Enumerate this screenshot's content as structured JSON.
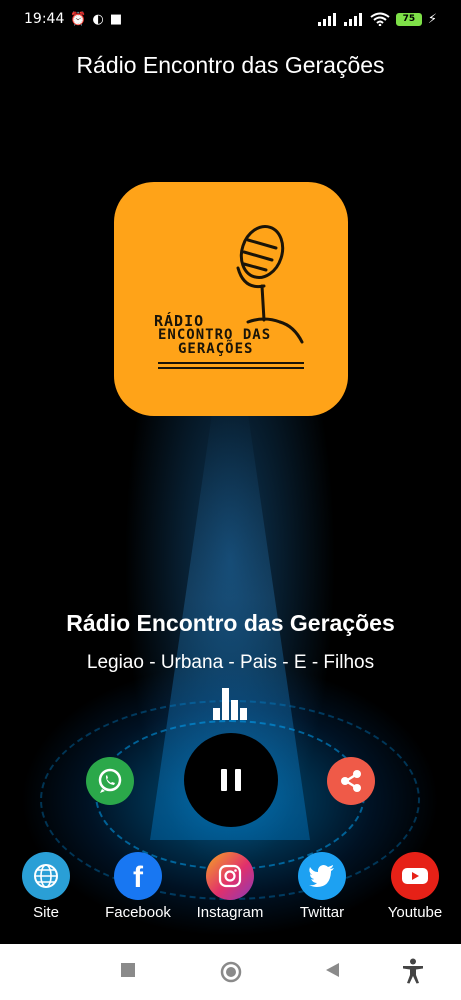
{
  "status_bar": {
    "time": "19:44",
    "battery": "75",
    "icons": [
      "alarm-icon",
      "app-notification-icon",
      "notification-icon",
      "signal-icon",
      "signal-icon",
      "wifi-icon",
      "battery-icon",
      "charging-icon"
    ]
  },
  "app": {
    "title": "Rádio Encontro das Gerações"
  },
  "logo": {
    "line1": "RÁDIO",
    "line2": "ENCONTRO DAS",
    "line3": "GERAÇÕES",
    "color": "#ffa318"
  },
  "now_playing": {
    "station": "Rádio Encontro das Gerações",
    "track": "Legiao - Urbana - Pais - E - Filhos",
    "equalizer_icon": "equalizer-icon"
  },
  "controls": {
    "whatsapp_icon": "whatsapp-icon",
    "play_state_icon": "pause-icon",
    "share_icon": "share-icon"
  },
  "social": [
    {
      "label": "Site",
      "icon": "globe-icon",
      "color": "#2a9fd6"
    },
    {
      "label": "Facebook",
      "icon": "facebook-icon",
      "color": "#1877f2"
    },
    {
      "label": "Instagram",
      "icon": "instagram-icon",
      "color": "#d6366f"
    },
    {
      "label": "Twittar",
      "icon": "twitter-icon",
      "color": "#1da1f2"
    },
    {
      "label": "Youtube",
      "icon": "youtube-icon",
      "color": "#e62117"
    }
  ],
  "nav_bar": {
    "icons": [
      "recents-icon",
      "home-icon",
      "back-icon",
      "accessibility-icon"
    ]
  }
}
